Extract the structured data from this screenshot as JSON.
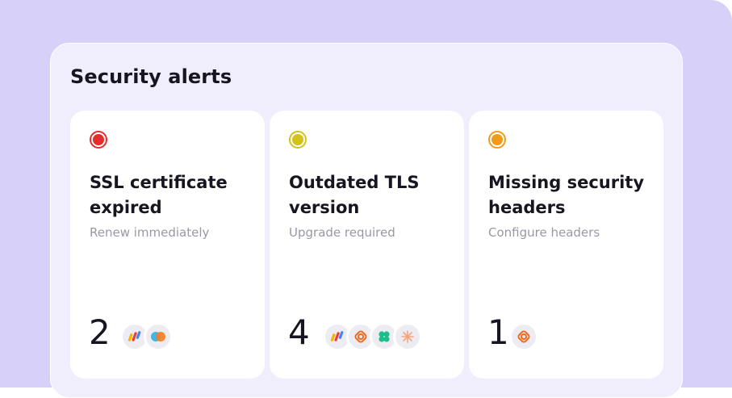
{
  "panel": {
    "title": "Security alerts"
  },
  "colors": {
    "critical": "#e52d2d",
    "warning": "#d4c11a",
    "caution": "#f09b1c"
  },
  "cards": [
    {
      "title": "SSL certificate expired",
      "subtitle": "Renew immediately",
      "count": "2",
      "severity": "critical",
      "icons": [
        "app-logo-icon",
        "overlap-circles-icon"
      ]
    },
    {
      "title": "Outdated TLS version",
      "subtitle": "Upgrade required",
      "count": "4",
      "severity": "warning",
      "icons": [
        "app-logo-icon",
        "orange-lattice-icon",
        "green-clover-icon",
        "orange-sparkle-icon"
      ]
    },
    {
      "title": "Missing security headers",
      "subtitle": "Configure headers",
      "count": "1",
      "severity": "caution",
      "icons": [
        "orange-lattice-icon"
      ]
    }
  ]
}
